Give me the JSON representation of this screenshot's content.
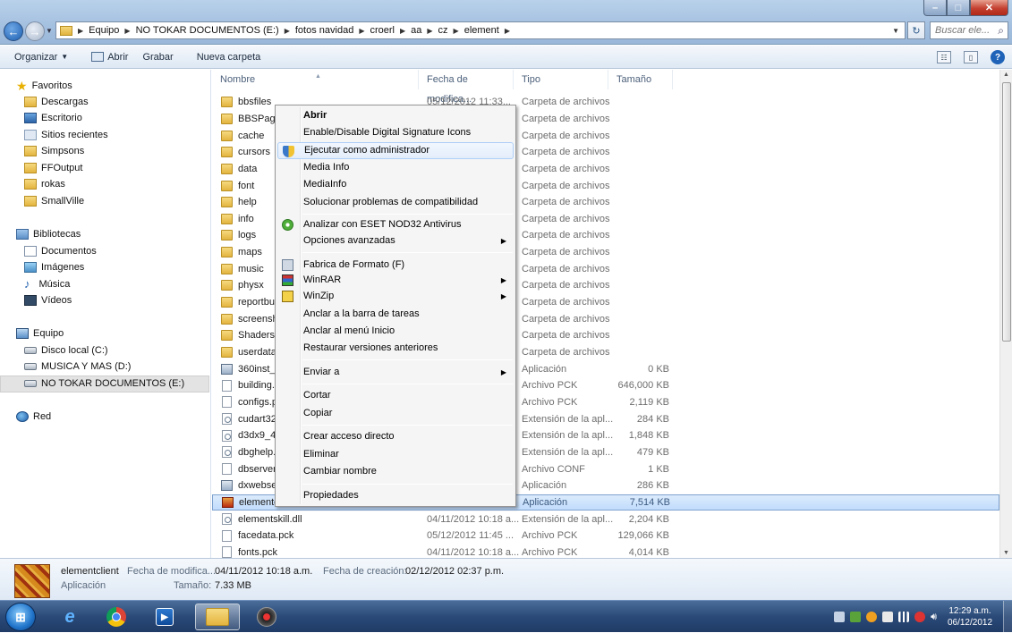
{
  "window": {
    "minimize": "–",
    "maximize": "□",
    "close": "✕"
  },
  "nav": {
    "back": "←",
    "forward": "→"
  },
  "address": {
    "crumbs": [
      "Equipo",
      "NO TOKAR DOCUMENTOS (E:)",
      "fotos navidad",
      "croerl",
      "aa",
      "cz",
      "element"
    ]
  },
  "search": {
    "placeholder": "Buscar ele..."
  },
  "toolbar": {
    "organize": "Organizar",
    "open": "Abrir",
    "burn": "Grabar",
    "new_folder": "Nueva carpeta"
  },
  "navpane": {
    "favorites": "Favoritos",
    "fav_items": [
      "Descargas",
      "Escritorio",
      "Sitios recientes",
      "Simpsons",
      "FFOutput",
      "rokas",
      "SmallVille"
    ],
    "libraries": "Bibliotecas",
    "lib_items": [
      "Documentos",
      "Imágenes",
      "Música",
      "Vídeos"
    ],
    "computer": "Equipo",
    "drives": [
      "Disco local (C:)",
      "MUSICA Y MAS (D:)",
      "NO TOKAR DOCUMENTOS (E:)"
    ],
    "network": "Red"
  },
  "columns": {
    "name": "Nombre",
    "date": "Fecha de modifica...",
    "type": "Tipo",
    "size": "Tamaño"
  },
  "files": [
    {
      "name": "bbsfiles",
      "date": "05/12/2012 11:33...",
      "type": "Carpeta de archivos",
      "size": "",
      "icon": "folder"
    },
    {
      "name": "BBSPages",
      "date": "",
      "type": "Carpeta de archivos",
      "size": "",
      "icon": "folder"
    },
    {
      "name": "cache",
      "date": "",
      "type": "Carpeta de archivos",
      "size": "",
      "icon": "folder"
    },
    {
      "name": "cursors",
      "date": "",
      "type": "Carpeta de archivos",
      "size": "",
      "icon": "folder"
    },
    {
      "name": "data",
      "date": "",
      "type": "Carpeta de archivos",
      "size": "",
      "icon": "folder"
    },
    {
      "name": "font",
      "date": "",
      "type": "Carpeta de archivos",
      "size": "",
      "icon": "folder"
    },
    {
      "name": "help",
      "date": "",
      "type": "Carpeta de archivos",
      "size": "",
      "icon": "folder"
    },
    {
      "name": "info",
      "date": "",
      "type": "Carpeta de archivos",
      "size": "",
      "icon": "folder"
    },
    {
      "name": "logs",
      "date": "",
      "type": "Carpeta de archivos",
      "size": "",
      "icon": "folder"
    },
    {
      "name": "maps",
      "date": "",
      "type": "Carpeta de archivos",
      "size": "",
      "icon": "folder"
    },
    {
      "name": "music",
      "date": "",
      "type": "Carpeta de archivos",
      "size": "",
      "icon": "folder"
    },
    {
      "name": "physx",
      "date": "",
      "type": "Carpeta de archivos",
      "size": "",
      "icon": "folder"
    },
    {
      "name": "reportbu",
      "date": "",
      "type": "Carpeta de archivos",
      "size": "",
      "icon": "folder"
    },
    {
      "name": "screensh",
      "date": "",
      "type": "Carpeta de archivos",
      "size": "",
      "icon": "folder"
    },
    {
      "name": "Shaders",
      "date": "",
      "type": "Carpeta de archivos",
      "size": "",
      "icon": "folder"
    },
    {
      "name": "userdata",
      "date": "",
      "type": "Carpeta de archivos",
      "size": "",
      "icon": "folder"
    },
    {
      "name": "360inst_v",
      "date": "",
      "type": "Aplicación",
      "size": "0 KB",
      "icon": "app"
    },
    {
      "name": "building.",
      "date": "",
      "type": "Archivo PCK",
      "size": "646,000 KB",
      "icon": "file"
    },
    {
      "name": "configs.p",
      "date": "",
      "type": "Archivo PCK",
      "size": "2,119 KB",
      "icon": "file"
    },
    {
      "name": "cudart32_",
      "date": "",
      "type": "Extensión de la apl...",
      "size": "284 KB",
      "icon": "dll"
    },
    {
      "name": "d3dx9_42",
      "date": "",
      "type": "Extensión de la apl...",
      "size": "1,848 KB",
      "icon": "dll"
    },
    {
      "name": "dbghelp.",
      "date": "",
      "type": "Extensión de la apl...",
      "size": "479 KB",
      "icon": "dll"
    },
    {
      "name": "dbserver.",
      "date": "",
      "type": "Archivo CONF",
      "size": "1 KB",
      "icon": "file"
    },
    {
      "name": "dxwebset",
      "date": "",
      "type": "Aplicación",
      "size": "286 KB",
      "icon": "app"
    },
    {
      "name": "elemento",
      "date": "",
      "type": "Aplicación",
      "size": "7,514 KB",
      "icon": "appred",
      "selected": true
    },
    {
      "name": "elementskill.dll",
      "date": "04/11/2012 10:18 a...",
      "type": "Extensión de la apl...",
      "size": "2,204 KB",
      "icon": "dll"
    },
    {
      "name": "facedata.pck",
      "date": "05/12/2012 11:45 ...",
      "type": "Archivo PCK",
      "size": "129,066 KB",
      "icon": "file"
    },
    {
      "name": "fonts.pck",
      "date": "04/11/2012 10:18 a...",
      "type": "Archivo PCK",
      "size": "4,014 KB",
      "icon": "file"
    }
  ],
  "context_menu": {
    "open": "Abrir",
    "signature": "Enable/Disable Digital Signature Icons",
    "run_admin": "Ejecutar como administrador",
    "media_info1": "Media Info",
    "media_info2": "MediaInfo",
    "compat": "Solucionar problemas de compatibilidad",
    "eset": "Analizar con ESET NOD32 Antivirus",
    "advanced": "Opciones avanzadas",
    "fabrica": "Fabrica de Formato (F)",
    "winrar": "WinRAR",
    "winzip": "WinZip",
    "pin_taskbar": "Anclar a la barra de tareas",
    "pin_start": "Anclar al menú Inicio",
    "restore": "Restaurar versiones anteriores",
    "send_to": "Enviar a",
    "cut": "Cortar",
    "copy": "Copiar",
    "shortcut": "Crear acceso directo",
    "delete": "Eliminar",
    "rename": "Cambiar nombre",
    "properties": "Propiedades"
  },
  "details": {
    "name": "elementclient",
    "type": "Aplicación",
    "modified_label": "Fecha de modifica...",
    "modified_value": "04/11/2012 10:18 a.m.",
    "created_label": "Fecha de creación:",
    "created_value": "02/12/2012 02:37 p.m.",
    "size_label": "Tamaño:",
    "size_value": "7.33 MB"
  },
  "taskbar": {
    "time": "12:29 a.m.",
    "date": "06/12/2012"
  }
}
